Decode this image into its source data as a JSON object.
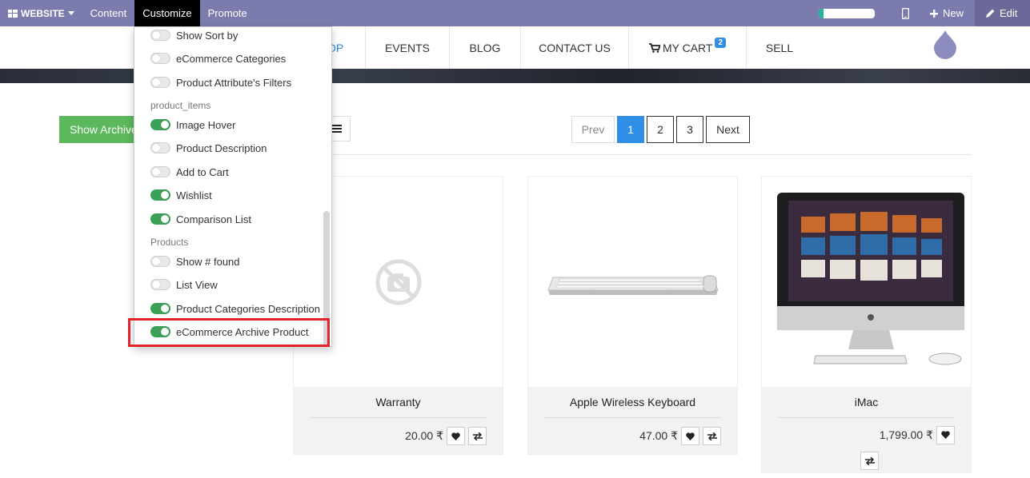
{
  "topbar": {
    "website_label": "WEBSITE",
    "menu": [
      {
        "label": "Content"
      },
      {
        "label": "Customize",
        "active": true
      },
      {
        "label": "Promote"
      }
    ],
    "progress_fraction": 0.08,
    "new_label": "New",
    "edit_label": "Edit",
    "accent_color": "#7c7bad"
  },
  "nav": {
    "items": [
      {
        "label": "OP"
      },
      {
        "label": "EVENTS"
      },
      {
        "label": "BLOG"
      },
      {
        "label": "CONTACT US"
      },
      {
        "label": "MY CART"
      },
      {
        "label": "SELL"
      }
    ],
    "cart_count": "2"
  },
  "toolbar": {
    "show_archive_label": "Show Archive",
    "pager": {
      "prev": "Prev",
      "pages": [
        "1",
        "2",
        "3"
      ],
      "active_page": "1",
      "next": "Next"
    }
  },
  "customize_menu": {
    "items": [
      {
        "type": "toggle",
        "label": "Show Sort by",
        "on": false
      },
      {
        "type": "toggle",
        "label": "eCommerce Categories",
        "on": false
      },
      {
        "type": "toggle",
        "label": "Product Attribute's Filters",
        "on": false
      },
      {
        "type": "header",
        "label": "product_items"
      },
      {
        "type": "toggle",
        "label": "Image Hover",
        "on": true
      },
      {
        "type": "toggle",
        "label": "Product Description",
        "on": false
      },
      {
        "type": "toggle",
        "label": "Add to Cart",
        "on": false
      },
      {
        "type": "toggle",
        "label": "Wishlist",
        "on": true
      },
      {
        "type": "toggle",
        "label": "Comparison List",
        "on": true
      },
      {
        "type": "header",
        "label": "Products"
      },
      {
        "type": "toggle",
        "label": "Show # found",
        "on": false
      },
      {
        "type": "toggle",
        "label": "List View",
        "on": false
      },
      {
        "type": "toggle",
        "label": "Product Categories Description",
        "on": true
      },
      {
        "type": "toggle",
        "label": "eCommerce Archive Product",
        "on": true
      }
    ],
    "highlight_color": "#e4222b"
  },
  "products": [
    {
      "name": "Warranty",
      "price": "20.00 ₹",
      "image": "no-image-icon"
    },
    {
      "name": "Apple Wireless Keyboard",
      "price": "47.00 ₹",
      "image": "keyboard-image"
    },
    {
      "name": "iMac",
      "price": "1,799.00 ₹",
      "image": "imac-image"
    }
  ]
}
